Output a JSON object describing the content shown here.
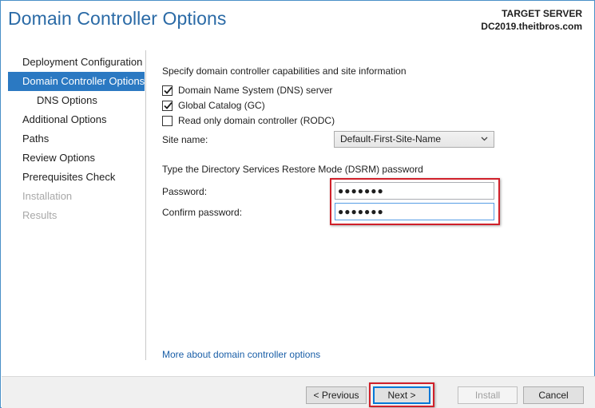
{
  "header": {
    "title": "Domain Controller Options",
    "target_label": "TARGET SERVER",
    "target_server": "DC2019.theitbros.com"
  },
  "nav": {
    "items": [
      {
        "label": "Deployment Configuration",
        "state": "normal"
      },
      {
        "label": "Domain Controller Options",
        "state": "active"
      },
      {
        "label": "DNS Options",
        "state": "sub"
      },
      {
        "label": "Additional Options",
        "state": "normal"
      },
      {
        "label": "Paths",
        "state": "normal"
      },
      {
        "label": "Review Options",
        "state": "normal"
      },
      {
        "label": "Prerequisites Check",
        "state": "normal"
      },
      {
        "label": "Installation",
        "state": "disabled"
      },
      {
        "label": "Results",
        "state": "disabled"
      }
    ]
  },
  "main": {
    "capabilities_heading": "Specify domain controller capabilities and site information",
    "checkboxes": [
      {
        "label": "Domain Name System (DNS) server",
        "checked": true
      },
      {
        "label": "Global Catalog (GC)",
        "checked": true
      },
      {
        "label": "Read only domain controller (RODC)",
        "checked": false
      }
    ],
    "site_name_label": "Site name:",
    "site_name_value": "Default-First-Site-Name",
    "dsrm_heading": "Type the Directory Services Restore Mode (DSRM) password",
    "password_label": "Password:",
    "password_value": "●●●●●●●",
    "confirm_label": "Confirm password:",
    "confirm_value": "●●●●●●●",
    "more_link": "More about domain controller options"
  },
  "footer": {
    "previous": "< Previous",
    "next": "Next >",
    "install": "Install",
    "cancel": "Cancel"
  },
  "colors": {
    "accent": "#2b79c2",
    "title": "#2a6aa6",
    "highlight_box": "#d0202a",
    "link": "#1a5fa8"
  }
}
